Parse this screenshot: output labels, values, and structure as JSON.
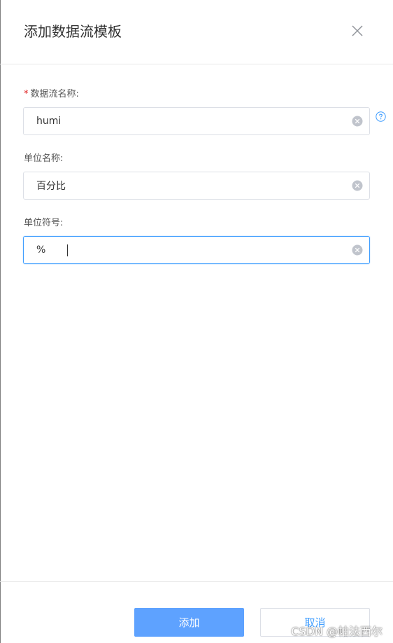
{
  "dialog": {
    "title": "添加数据流模板"
  },
  "form": {
    "fields": [
      {
        "label": "数据流名称:",
        "required": true,
        "required_mark": "*",
        "value": "humi"
      },
      {
        "label": "单位名称:",
        "required": false,
        "value": "百分比"
      },
      {
        "label": "单位符号:",
        "required": false,
        "value": "%"
      }
    ]
  },
  "footer": {
    "confirm_label": "添加",
    "cancel_label": "取消"
  },
  "watermark": "CSDN @帕法西尔",
  "colors": {
    "primary": "#5ea2ff",
    "focus_border": "#409eff",
    "required": "#e02020",
    "border": "#dcdfe6"
  },
  "icons": [
    "close-icon",
    "clear-icon",
    "help-icon"
  ]
}
